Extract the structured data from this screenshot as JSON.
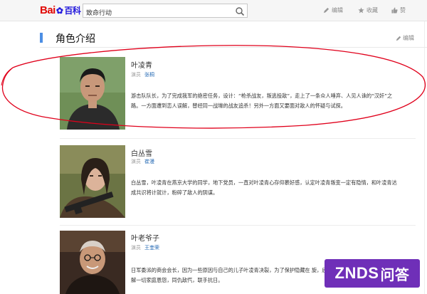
{
  "header": {
    "logo": {
      "left": "Bai",
      "right": "百科",
      "icon": "baidu-paw-icon"
    },
    "search": {
      "value": "致命行动",
      "placeholder": ""
    },
    "tools": [
      {
        "label": "编辑",
        "icon": "pencil-icon"
      },
      {
        "label": "收藏",
        "icon": "star-icon"
      },
      {
        "label": "赞",
        "icon": "thumbs-up-icon"
      }
    ]
  },
  "section": {
    "title": "角色介绍",
    "edit_label": "编辑"
  },
  "characters": [
    {
      "name": "叶凌青",
      "actor_label": "演员",
      "actor": "张桐",
      "desc": "游击队队长，为了完成我军的绝密任务，设计：“枪杀战友，叛逃投敌”，走上了一条众人唾弃、人见人诛的“汉奸”之路。一方面遭到恋人误解，替经同一战壕的战友追杀！另外一方面又要面对敌人的怀疑与试探。"
    },
    {
      "name": "白丛雪",
      "actor_label": "演员",
      "actor": "崔漫",
      "desc": "白丛雪，叶凌青在燕京大学的同学，地下党员，一直对叶凌青心存仰慕好感，认定叶凌青叛变一定有隐情，和叶凌青达成共识将计就计，粉碎了敌人的阴谋。"
    },
    {
      "name": "叶老爷子",
      "actor_label": "演员",
      "actor": "王奎荣",
      "desc": "日军委派的商会会长，因为一些原因与自己的儿子叶凌青决裂，为了保护隐藏在 旋，后父子两人终于因为国家大义化解一切家庭恩怨，同仇敌忾，联手抗日。"
    }
  ],
  "watermark": {
    "text_a": "ZNDS",
    "text_b": "问答"
  },
  "colors": {
    "accent": "#4c8ee4",
    "link": "#2a6db6",
    "annotation": "#e0001b",
    "watermark": "#6f2fb8",
    "logo_red": "#e10602",
    "logo_blue": "#2319dc"
  }
}
